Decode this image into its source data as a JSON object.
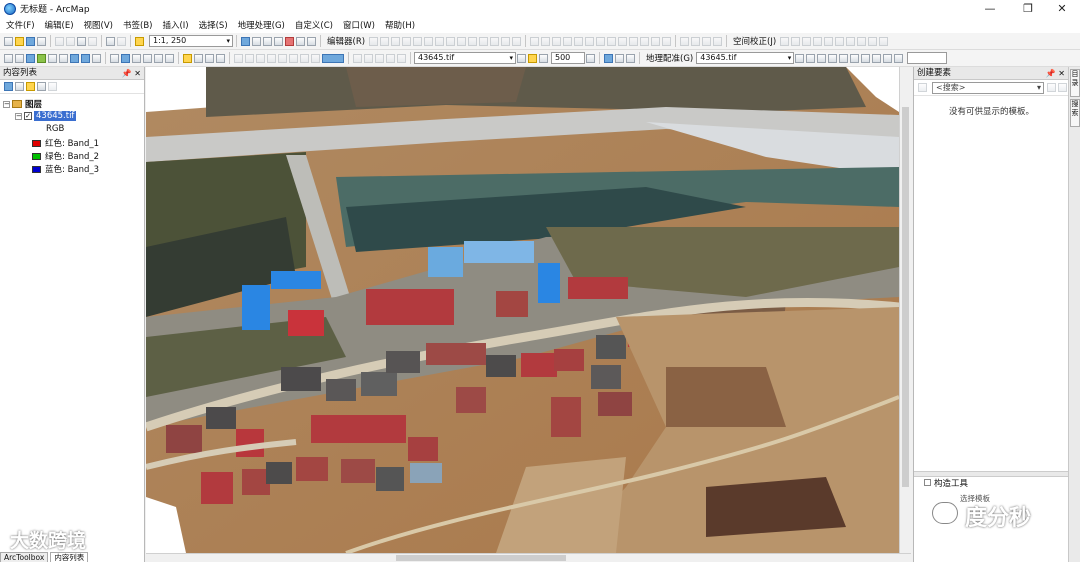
{
  "window": {
    "title": "无标题 - ArcMap",
    "minimize_glyph": "—",
    "maximize_glyph": "❐",
    "close_glyph": "✕"
  },
  "menu": [
    "文件(F)",
    "编辑(E)",
    "视图(V)",
    "书签(B)",
    "插入(I)",
    "选择(S)",
    "地理处理(G)",
    "自定义(C)",
    "窗口(W)",
    "帮助(H)"
  ],
  "toolbar1": {
    "scale": "1:1, 250",
    "editor_label": "编辑器(R)",
    "spatial_adjust_label": "空间校正(J)"
  },
  "toolbar2": {
    "layer_select": "43645.tif",
    "size_value": "500",
    "georef_label": "地理配准(G)",
    "georef_layer": "43645.tif"
  },
  "toc": {
    "title": "内容列表",
    "group_label": "图层",
    "layer_name": "43645.tif",
    "rgb_label": "RGB",
    "bands": [
      {
        "label": "红色:   Band_1",
        "color": "#e00000"
      },
      {
        "label": "绿色: Band_2",
        "color": "#00c000"
      },
      {
        "label": "蓝色:   Band_3",
        "color": "#0000d0"
      }
    ],
    "tabs": [
      "ArcToolbox",
      "内容列表"
    ]
  },
  "create_features": {
    "title": "创建要素",
    "search_placeholder": "<搜索>",
    "empty_message": "没有可供显示的模板。",
    "construct_title": "构造工具",
    "construct_sub": "选择模板"
  },
  "rail_tabs": [
    "目录",
    "搜索"
  ],
  "watermarks": {
    "left": "大数跨境",
    "right": "度分秒"
  }
}
